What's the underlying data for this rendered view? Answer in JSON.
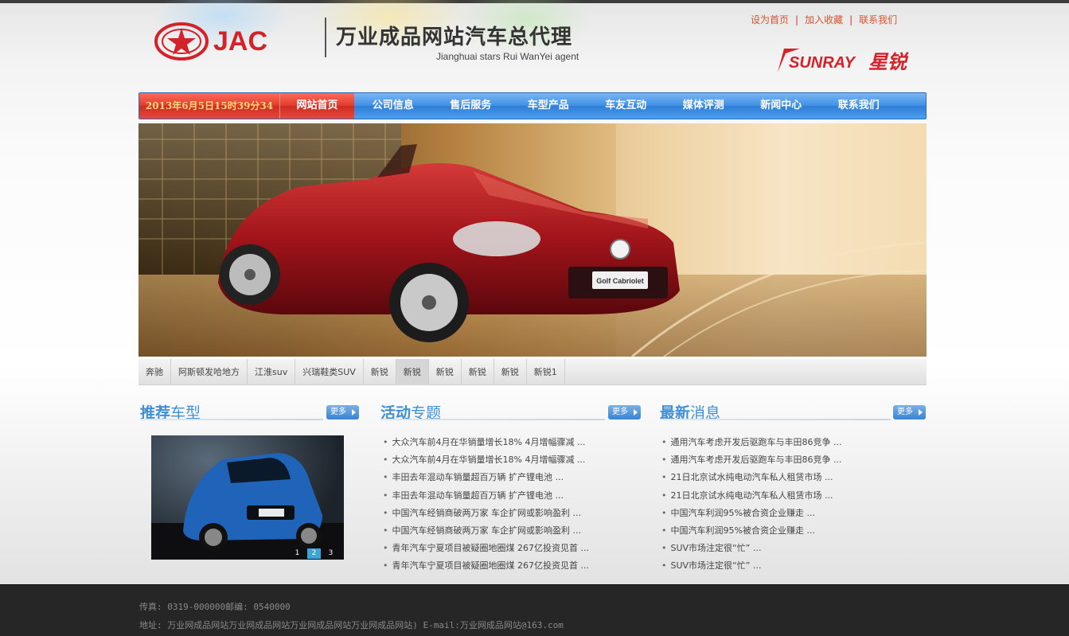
{
  "header": {
    "logo_text": "JAC",
    "slogan_cn": "万业成品网站汽车总代理",
    "slogan_en": "Jianghuai stars Rui WanYei agent",
    "brand_logo_text": "SUNRAY",
    "brand_logo_cn": "星锐",
    "links": [
      "设为首页",
      "加入收藏",
      "联系我们"
    ]
  },
  "nav": {
    "datetime": "2013年6月5日15时39分34",
    "home": "网站首页",
    "items": [
      "公司信息",
      "售后服务",
      "车型产品",
      "车友互动",
      "媒体评测",
      "新闻中心",
      "联系我们"
    ]
  },
  "banner": {
    "plate_text": "Golf Cabriolet"
  },
  "tabs": [
    "奔驰",
    "阿斯顿发哈地方",
    "江淮suv",
    "兴瑞鞋类SUV",
    "新锐",
    "新锐",
    "新锐",
    "新锐",
    "新锐",
    "新锐1"
  ],
  "sections": {
    "recommend": {
      "title_a": "推荐",
      "title_b": "车型",
      "more": "更多"
    },
    "activity": {
      "title_a": "活动",
      "title_b": "专题",
      "more": "更多"
    },
    "news": {
      "title_a": "最新",
      "title_b": "消息",
      "more": "更多"
    }
  },
  "slider": {
    "pages": [
      "1",
      "2",
      "3"
    ],
    "active": 2
  },
  "activity_list": [
    "大众汽车前4月在华销量增长18% 4月增幅骤减 ...",
    "大众汽车前4月在华销量增长18% 4月增幅骤减 ...",
    "丰田去年混动车销量超百万辆 扩产锂电池 ...",
    "丰田去年混动车销量超百万辆 扩产锂电池 ...",
    "中国汽车经销商破两万家 车企扩网或影响盈利 ...",
    "中国汽车经销商破两万家 车企扩网或影响盈利 ...",
    "青年汽车宁夏项目被疑圈地圈煤 267亿投资见首 ...",
    "青年汽车宁夏项目被疑圈地圈煤 267亿投资见首 ..."
  ],
  "news_list": [
    "通用汽车考虑开发后驱跑车与丰田86竞争 ...",
    "通用汽车考虑开发后驱跑车与丰田86竞争 ...",
    "21日北京试水纯电动汽车私人租赁市场 ...",
    "21日北京试水纯电动汽车私人租赁市场 ...",
    "中国汽车利润95%被合资企业赚走 ...",
    "中国汽车利润95%被合资企业赚走 ...",
    "SUV市场注定很“忙” ...",
    "SUV市场注定很“忙” ..."
  ],
  "footer": {
    "line1": "传真: 0319-000000邮编: 0540000",
    "line2": "地址: 万业网成品网站万业网成品网站万业网成品网站万业网成品网站) E-mail:万业网成品网站@163.com"
  },
  "colors": {
    "nav_blue": "#3f8fe6",
    "nav_red": "#e03a2c",
    "link_orange": "#d9532c",
    "section_blue": "#3f8fd8",
    "footer_bg": "#262626"
  }
}
